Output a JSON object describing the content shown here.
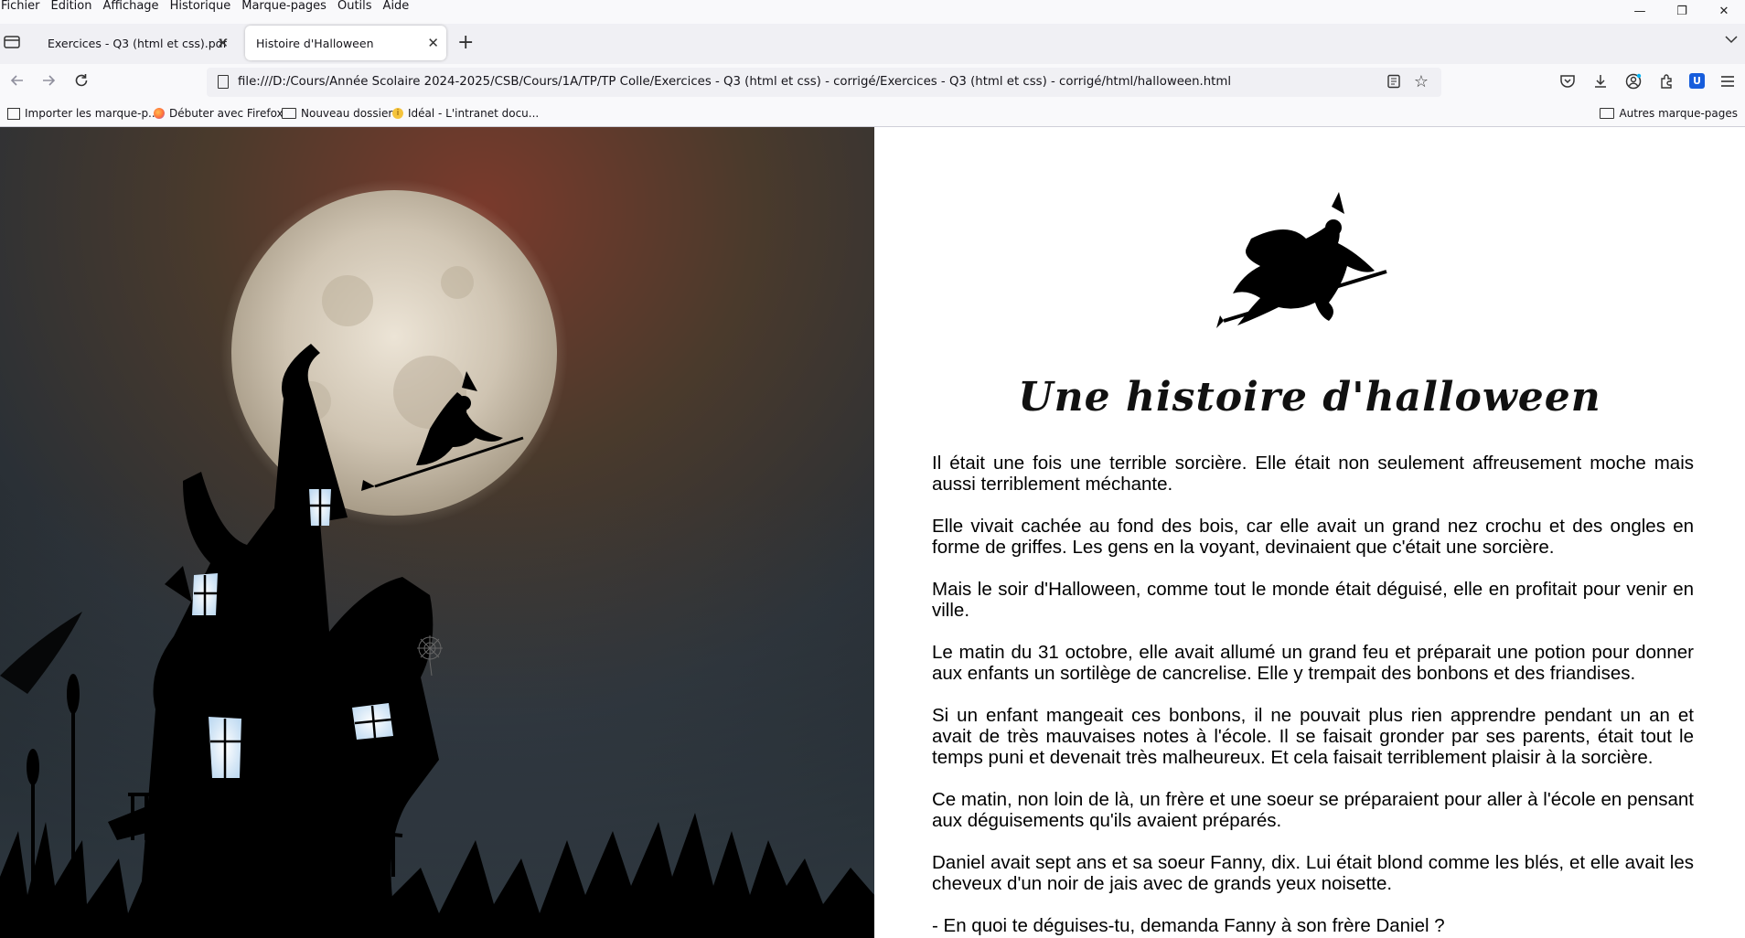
{
  "menu": [
    "Fichier",
    "Edition",
    "Affichage",
    "Historique",
    "Marque-pages",
    "Outils",
    "Aide"
  ],
  "window_controls": {
    "minimize": "—",
    "restore": "❐",
    "close": "✕"
  },
  "tabs": [
    {
      "label": "Exercices - Q3 (html et css).pdf",
      "active": false
    },
    {
      "label": "Histoire d'Halloween",
      "active": true
    }
  ],
  "tab_close_glyph": "✕",
  "new_tab_glyph": "+",
  "url": "file:///D:/Cours/Année Scolaire 2024-2025/CSB/Cours/1A/TP/TP Colle/Exercices - Q3 (html et css) - corrigé/Exercices - Q3 (html et css) - corrigé/html/halloween.html",
  "bookmarks": [
    {
      "label": "Importer les marque-p...",
      "icon": "import-icon"
    },
    {
      "label": "Débuter avec Firefox",
      "icon": "firefox-icon"
    },
    {
      "label": "Nouveau dossier",
      "icon": "folder-icon"
    },
    {
      "label": "Idéal - L'intranet docu...",
      "icon": "ideal-icon"
    }
  ],
  "other_bookmarks": "Autres marque-pages",
  "page": {
    "title": "Une histoire d'halloween",
    "paragraphs": [
      "Il était une fois une terrible sorcière. Elle était non seulement affreusement moche mais aussi terriblement méchante.",
      "Elle vivait cachée au fond des bois, car elle avait un grand nez crochu et des ongles en forme de griffes. Les gens en la voyant, devinaient que c'était une sorcière.",
      "Mais le soir d'Halloween, comme tout le monde était déguisé, elle en profitait pour venir en ville.",
      "Le matin du 31 octobre, elle avait allumé un grand feu et préparait une potion pour donner aux enfants un sortilège de cancrelise. Elle y trempait des bonbons et des friandises.",
      "Si un enfant mangeait ces bonbons, il ne pouvait plus rien apprendre pendant un an et avait de très mauvaises notes à l'école. Il se faisait gronder par ses parents, était tout le temps puni et devenait très malheureux. Et cela faisait terriblement plaisir à la sorcière.",
      "Ce matin, non loin de là, un frère et une soeur se préparaient pour aller à l'école en pensant aux déguisements qu'ils avaient préparés.",
      "Daniel avait sept ans et sa soeur Fanny, dix. Lui était blond comme les blés, et elle avait les cheveux d'un noir de jais avec de grands yeux noisette.",
      "- En quoi te déguises-tu, demanda Fanny à son frère Daniel ?"
    ]
  }
}
